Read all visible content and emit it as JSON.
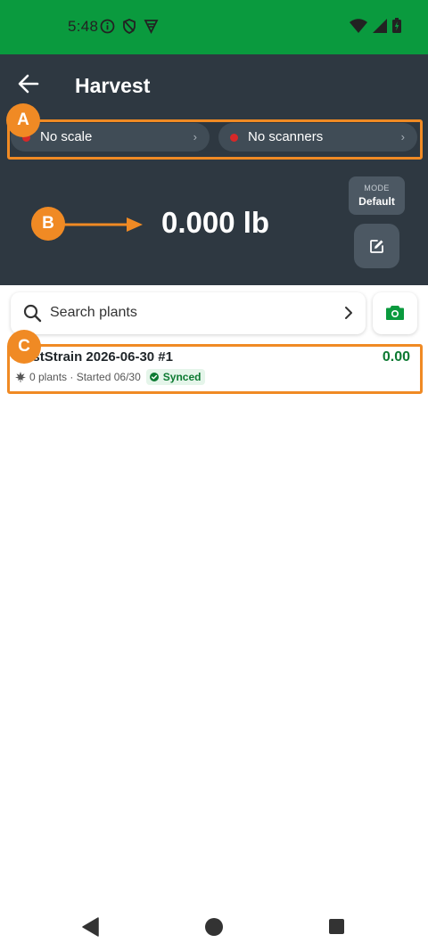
{
  "status_bar": {
    "time": "5:48",
    "color": "#0a9a3e",
    "icons_left": [
      "info-icon",
      "shield-icon",
      "vpn-icon"
    ],
    "icons_right": [
      "wifi-icon",
      "signal-icon",
      "battery-icon"
    ]
  },
  "header": {
    "title": "Harvest",
    "back_icon": "arrow-left-icon",
    "background": "#2e3841",
    "scale_chip": {
      "label": "No scale",
      "status_color": "#d62828"
    },
    "scanners_chip": {
      "label": "No scanners",
      "status_color": "#d62828"
    },
    "weight": "0.000 lb",
    "mode": {
      "label": "MODE",
      "value": "Default"
    },
    "edit_icon": "edit-icon"
  },
  "search": {
    "placeholder": "Search plants",
    "camera_icon": "camera-icon"
  },
  "batches": [
    {
      "name": "TestStrain 2026-06-30 #1",
      "weight": "0.00",
      "plants": "0 plants",
      "started": "Started 06/30",
      "sync_status": "Synced"
    }
  ],
  "annotations": {
    "a": "A",
    "b": "B",
    "c": "C",
    "color": "#f08a24"
  },
  "nav": {
    "icons": [
      "nav-back-icon",
      "nav-home-icon",
      "nav-recents-icon"
    ]
  }
}
